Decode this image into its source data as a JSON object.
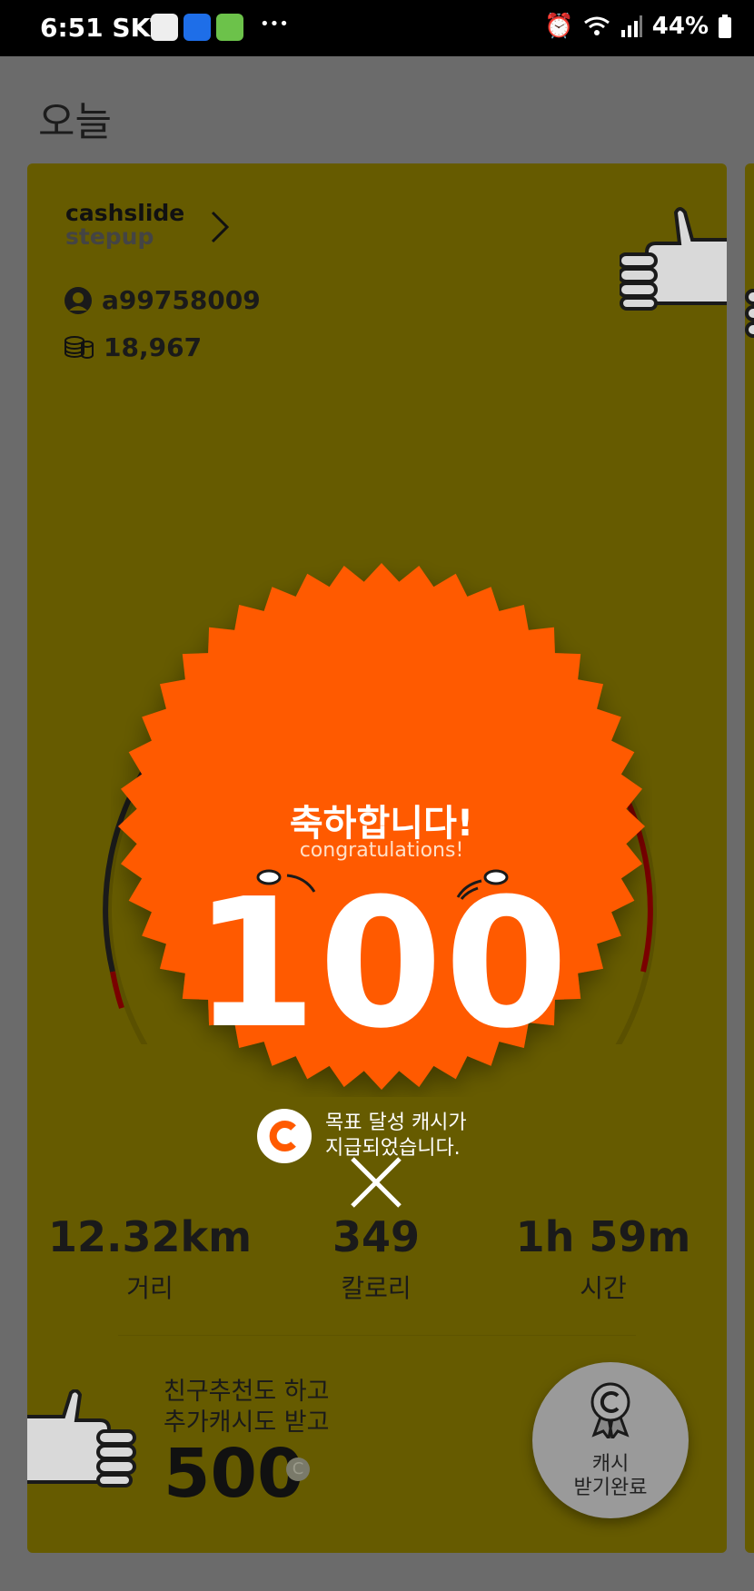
{
  "status_bar": {
    "time": "6:51",
    "carrier": "SKT",
    "battery": "44%",
    "more": "•••"
  },
  "page": {
    "title": "오늘"
  },
  "card": {
    "brand_line1": "cashslide",
    "brand_line2": "stepup",
    "user_id": "a99758009",
    "coins": "18,967",
    "badge": {
      "title": "축하합니다!",
      "subtitle": "congratulations!",
      "amount": "100",
      "message_line1": "목표 달성 캐시가",
      "message_line2": "지급되었습니다."
    },
    "stats": [
      {
        "value": "12.32km",
        "label": "거리"
      },
      {
        "value": "349",
        "label": "칼로리"
      },
      {
        "value": "1h 59m",
        "label": "시간"
      }
    ],
    "promo": {
      "line1": "친구추천도 하고",
      "line2": "추가캐시도 받고",
      "amount": "500"
    },
    "cash_button": {
      "line1": "캐시",
      "line2": "받기완료"
    }
  },
  "colors": {
    "card_bg": "#665b00",
    "badge_orange": "#ff5a00",
    "page_bg": "#6b6b6b"
  }
}
